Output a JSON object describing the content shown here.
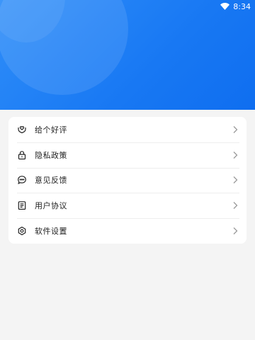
{
  "status": {
    "time": "8:34",
    "wifi_icon": "wifi-icon"
  },
  "header": {
    "color": "#1878f3"
  },
  "menu": {
    "items": [
      {
        "key": "rate",
        "label": "给个好评",
        "icon": "heart-hand-icon"
      },
      {
        "key": "privacy",
        "label": "隐私政策",
        "icon": "lock-icon"
      },
      {
        "key": "feedback",
        "label": "意见反馈",
        "icon": "chat-icon"
      },
      {
        "key": "agreement",
        "label": "用户协议",
        "icon": "document-icon"
      },
      {
        "key": "settings",
        "label": "软件设置",
        "icon": "settings-icon"
      }
    ]
  }
}
